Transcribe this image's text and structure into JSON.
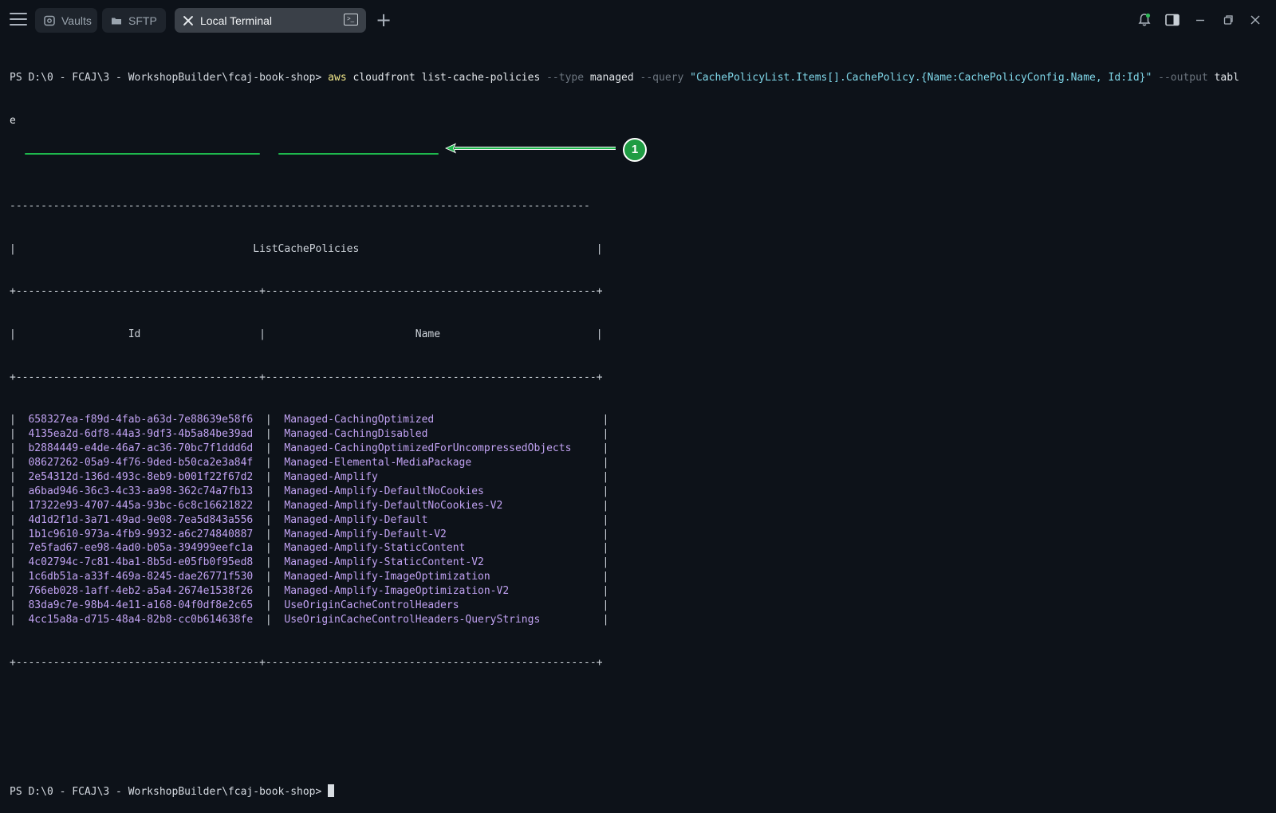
{
  "tabs": {
    "vaults": "Vaults",
    "sftp": "SFTP",
    "terminal": "Local Terminal"
  },
  "icons": {
    "menu": "hamburger-menu-icon",
    "vaults": "vault-icon",
    "sftp": "folder-icon",
    "close_tab": "close-icon",
    "terminal": "terminal-icon",
    "add_tab": "plus-icon",
    "notifications": "bell-icon",
    "panel": "side-panel-icon",
    "minimize": "minimize-icon",
    "maximize": "restore-icon",
    "close_window": "close-icon"
  },
  "colors": {
    "background": "#0d1219",
    "active_tab": "#3a4048",
    "command": "#f2e88a",
    "string": "#80d8ea",
    "flag": "#6c757f",
    "table_values": "#c1a2f2",
    "annotation": "#1eb84d"
  },
  "terminal": {
    "prompt": "PS D:\\0 - FCAJ\\3 - WorkshopBuilder\\fcaj-book-shop> ",
    "command": {
      "cmd": "aws",
      "args1": " cloudfront list-cache-policies ",
      "flag_type": "--type",
      "val_type": " managed ",
      "flag_query": "--query",
      "val_query": " \"CachePolicyList.Items[].CachePolicy.{Name:CachePolicyConfig.Name, Id:Id}\" ",
      "flag_output": "--output",
      "val_output_1": " tabl",
      "val_output_2": "e"
    },
    "table": {
      "title": "ListCachePolicies",
      "col_id": "Id",
      "col_name": "Name",
      "rows": [
        {
          "id": "658327ea-f89d-4fab-a63d-7e88639e58f6",
          "name": "Managed-CachingOptimized"
        },
        {
          "id": "4135ea2d-6df8-44a3-9df3-4b5a84be39ad",
          "name": "Managed-CachingDisabled"
        },
        {
          "id": "b2884449-e4de-46a7-ac36-70bc7f1ddd6d",
          "name": "Managed-CachingOptimizedForUncompressedObjects"
        },
        {
          "id": "08627262-05a9-4f76-9ded-b50ca2e3a84f",
          "name": "Managed-Elemental-MediaPackage"
        },
        {
          "id": "2e54312d-136d-493c-8eb9-b001f22f67d2",
          "name": "Managed-Amplify"
        },
        {
          "id": "a6bad946-36c3-4c33-aa98-362c74a7fb13",
          "name": "Managed-Amplify-DefaultNoCookies"
        },
        {
          "id": "17322e93-4707-445a-93bc-6c8c16621822",
          "name": "Managed-Amplify-DefaultNoCookies-V2"
        },
        {
          "id": "4d1d2f1d-3a71-49ad-9e08-7ea5d843a556",
          "name": "Managed-Amplify-Default"
        },
        {
          "id": "1b1c9610-973a-4fb9-9932-a6c274840887",
          "name": "Managed-Amplify-Default-V2"
        },
        {
          "id": "7e5fad67-ee98-4ad0-b05a-394999eefc1a",
          "name": "Managed-Amplify-StaticContent"
        },
        {
          "id": "4c02794c-7c81-4ba1-8b5d-e05fb0f95ed8",
          "name": "Managed-Amplify-StaticContent-V2"
        },
        {
          "id": "1c6db51a-a33f-469a-8245-dae26771f530",
          "name": "Managed-Amplify-ImageOptimization"
        },
        {
          "id": "766eb028-1aff-4eb2-a5a4-2674e1538f26",
          "name": "Managed-Amplify-ImageOptimization-V2"
        },
        {
          "id": "83da9c7e-98b4-4e11-a168-04f0df8e2c65",
          "name": "UseOriginCacheControlHeaders"
        },
        {
          "id": "4cc15a8a-d715-48a4-82b8-cc0b614638fe",
          "name": "UseOriginCacheControlHeaders-QueryStrings"
        }
      ]
    },
    "final_prompt": "PS D:\\0 - FCAJ\\3 - WorkshopBuilder\\fcaj-book-shop> "
  },
  "annotation": {
    "badge": "1"
  }
}
